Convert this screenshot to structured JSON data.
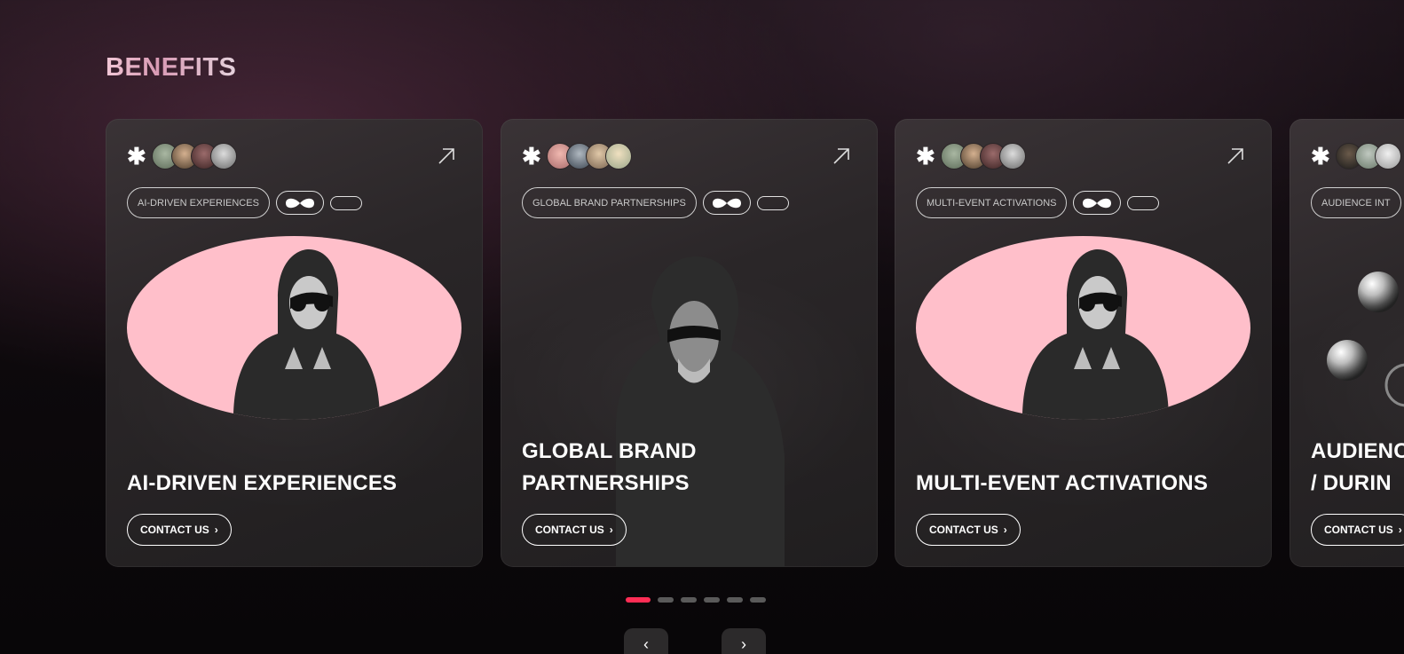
{
  "section": {
    "title": "BENEFITS"
  },
  "cards": [
    {
      "tag": "AI-DRIVEN EXPERIENCES",
      "title": "AI-DRIVEN EXPERIENCES",
      "button": "CONTACT US"
    },
    {
      "tag": "GLOBAL BRAND PARTNERSHIPS",
      "title_line1": "GLOBAL BRAND",
      "title_line2": "PARTNERSHIPS",
      "button": "CONTACT US"
    },
    {
      "tag": "MULTI-EVENT ACTIVATIONS",
      "title": "MULTI-EVENT ACTIVATIONS",
      "button": "CONTACT US"
    },
    {
      "tag": "AUDIENCE INT",
      "title_line1": "AUDIENC",
      "title_line2": "/ DURIN",
      "button": "CONTACT US"
    }
  ],
  "carousel": {
    "slides": 6,
    "active_index": 0
  },
  "icons": {
    "asterisk": "asterisk-icon",
    "arrow": "arrow-up-right-icon",
    "chevron_right": "chevron-right-icon",
    "chevron_left": "chevron-left-icon",
    "infinity": "infinity-icon"
  },
  "colors": {
    "accent": "#ff2d55",
    "pink_shape": "#ffbfca",
    "card_bg": "#2a2628"
  }
}
